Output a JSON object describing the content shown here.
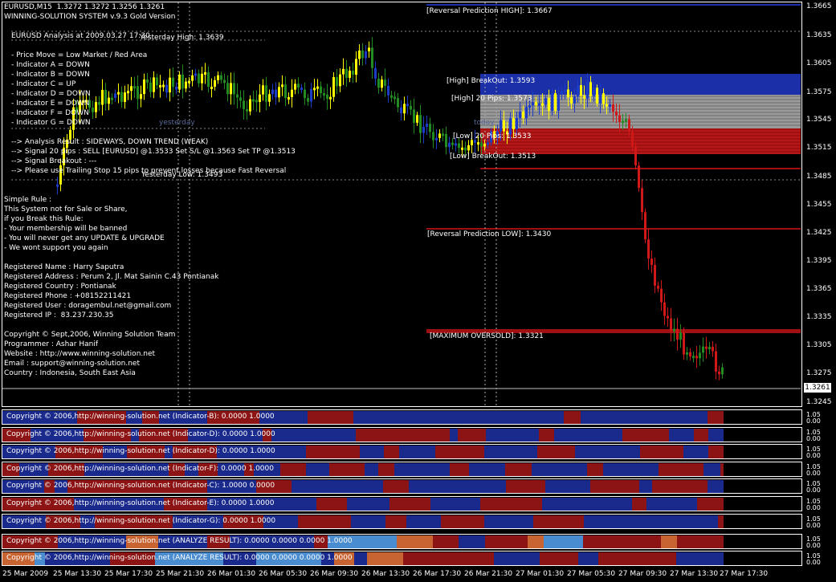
{
  "header": {
    "symbol_line": "EURUSD,M15  1.3272 1.3272 1.3256 1.3261",
    "system_line": "WINNING-SOLUTION SYSTEM v.9.3 Gold Version"
  },
  "analysis": {
    "title": "EURUSD Analysis at 2009.03.27 17:30",
    "lines": [
      "- Price Move = Low Market / Red Area",
      "- Indicator A = DOWN",
      "- Indicator B = DOWN",
      "- Indicator C = UP",
      "- Indicator D = DOWN",
      "- Indicator E = DOWN",
      "- Indicator F = DOWN",
      "- Indicator G = DOWN"
    ],
    "results": [
      "--> Analysis Result : SIDEWAYS, DOWN TREND (WEAK)",
      "--> Signal 20 pips : SELL [EURUSD] @1.3533 Set S/L @1.3563 Set TP @1.3513",
      "--> Signal Breakout : ---",
      "--> Please use Trailing Stop 15 pips to prevent losses because Fast Reversal"
    ],
    "rules": [
      "Simple Rule :",
      "This System not for Sale or Share,",
      "if you Break this Rule:",
      "- Your membership will be banned",
      "- You will never get any UPDATE & UPGRADE",
      "- We wont support you again"
    ],
    "registration": [
      "Registered Name : Harry Saputra",
      "Registered Address : Perum 2, Jl. Mat Sainin C.43 Pontianak",
      "Registered Country : Pontianak",
      "Registered Phone : +08152211421",
      "Registered User : doragembul.net@gmail.com",
      "Registered IP :  83.237.230.35"
    ],
    "credits": [
      "Copyright © Sept,2006, Winning Solution Team",
      "Programmer : Ashar Hanif",
      "Website : http://www.winning-solution.net",
      "Email : support@winning-solution.net",
      "Country : Indonesia, South East Asia"
    ]
  },
  "levels": {
    "yesterday_high": "Yesterday High: 1.3639",
    "yesterday_low": "Yesterday Low: 1.3493",
    "yesterday": "yesterday",
    "today": "today",
    "reversal_high": "[Reversal Prediction HIGH]: 1.3667",
    "high_breakout": "[High] BreakOut: 1.3593",
    "high_20": "[High] 20 Pips: 1.3573",
    "low_20": "[Low] 20 Pips: 1.3533",
    "low_breakout": "[Low] BreakOut: 1.3513",
    "reversal_low": "[Reversal Prediction LOW]: 1.3430",
    "max_oversold": "[MAXIMUM OVERSOLD]: 1.3321"
  },
  "price_axis": [
    "1.3665",
    "1.3635",
    "1.3605",
    "1.3575",
    "1.3545",
    "1.3515",
    "1.3485",
    "1.3455",
    "1.3425",
    "1.3395",
    "1.3365",
    "1.3335",
    "1.3305",
    "1.3275",
    "1.3245"
  ],
  "last_price": "1.3261",
  "time_axis": [
    "25 Mar 2009",
    "25 Mar 13:30",
    "25 Mar 17:30",
    "25 Mar 21:30",
    "26 Mar 01:30",
    "26 Mar 05:30",
    "26 Mar 09:30",
    "26 Mar 13:30",
    "26 Mar 17:30",
    "26 Mar 21:30",
    "27 Mar 01:30",
    "27 Mar 05:30",
    "27 Mar 09:30",
    "27 Mar 13:30",
    "27 Mar 17:30"
  ],
  "panels": [
    {
      "label": "Copyright © 2006,http://winning-solution.net (Indicator-B): 0.0000 1.0000",
      "ticks": [
        "1.05",
        "0.00"
      ]
    },
    {
      "label": "Copyright © 2006,http://winning-solution.net (Indicator-D): 0.0000 1.0000",
      "ticks": [
        "1.05",
        "0.00"
      ]
    },
    {
      "label": "Copyright © 2006,http://winning-solution.net (Indicator-D): 0.0000 1.0000",
      "ticks": [
        "1.05",
        "0.00"
      ]
    },
    {
      "label": "Copyright © 2006,http://winning-solution.net (Indicator-F): 0.0000 1.0000",
      "ticks": [
        "1.05",
        "0.00"
      ]
    },
    {
      "label": "Copyright © 2006,http://winning-solution.net (Indicator-C): 1.0000 0.0000",
      "ticks": [
        "1.05",
        "0.00"
      ]
    },
    {
      "label": "Copyright © 2006,http://winning-solution.net (Indicator-E): 0.0000 1.0000",
      "ticks": [
        "1.05",
        "0.00"
      ]
    },
    {
      "label": "Copyright © 2006,http://winning-solution.net (Indicator-G): 0.0000 1.0000",
      "ticks": [
        "1.05",
        "0.00"
      ]
    },
    {
      "label": "Copyright © 2006,http://winning-solution.net (ANALYZE RESULT): 0.0000 0.0000 0.0000 1.0000",
      "ticks": [
        "1.05",
        "0.00"
      ]
    },
    {
      "label": "Copyright © 2006,http://winning-solution.net (ANALYZE RESULT): 0.0000 0.0000 0.0000 1.0000",
      "ticks": [
        "1.05",
        "0.00"
      ]
    }
  ],
  "colors": {
    "bull_candle": "#ffff00",
    "bear_candle": "#228b22",
    "blue_candle": "#1c3cc8",
    "red_candle": "#d01818",
    "zone_blue": "#1a2fa8",
    "zone_gray": "#9a9a9a",
    "zone_red": "#a01010",
    "panel_blue": "#1a2a8c",
    "panel_red": "#8c1414",
    "panel_orange": "#c86432",
    "panel_lightblue": "#4a8cd0"
  }
}
